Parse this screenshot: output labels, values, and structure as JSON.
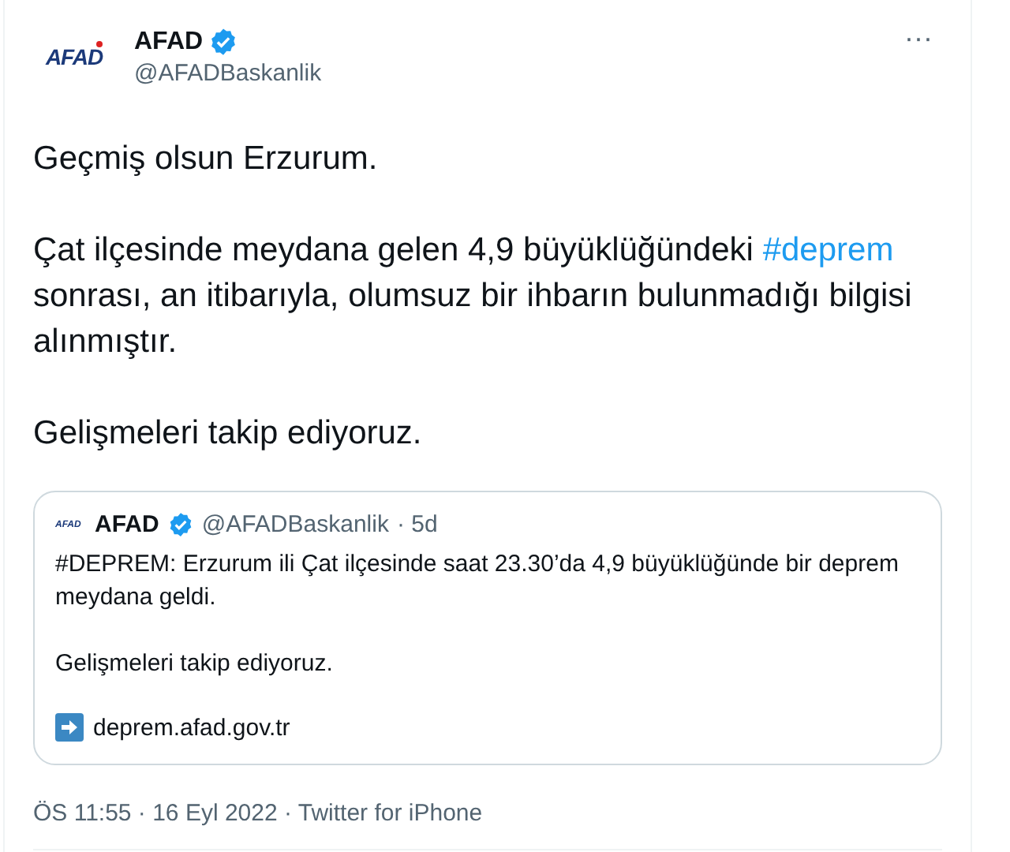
{
  "tweet": {
    "avatar_logo": "AFAD",
    "name": "AFAD",
    "verified": true,
    "handle": "@AFADBaskanlik",
    "more": "···",
    "paragraphs": [
      [
        {
          "kind": "text",
          "text": "Geçmiş olsun Erzurum."
        }
      ],
      [
        {
          "kind": "text",
          "text": "Çat ilçesinde meydana gelen 4,9 büyüklüğündeki "
        },
        {
          "kind": "hashtag",
          "text": "#deprem"
        },
        {
          "kind": "text",
          "text": " sonrası, an itibarıyla, olumsuz bir ihbarın bulunmadığı bilgisi alınmıştır."
        }
      ],
      [
        {
          "kind": "text",
          "text": "Gelişmeleri takip ediyoruz."
        }
      ]
    ],
    "quote": {
      "avatar_logo": "AFAD",
      "name": "AFAD",
      "verified": true,
      "handle": "@AFADBaskanlik",
      "time": "· 5d",
      "paragraphs": [
        "#DEPREM: Erzurum ili Çat ilçesinde saat 23.30’da 4,9 büyüklüğünde bir deprem meydana geldi.",
        "Gelişmeleri takip ediyoruz."
      ],
      "link": "deprem.afad.gov.tr"
    },
    "meta": "ÖS 11:55 · 16 Eyl 2022 · Twitter for iPhone"
  }
}
